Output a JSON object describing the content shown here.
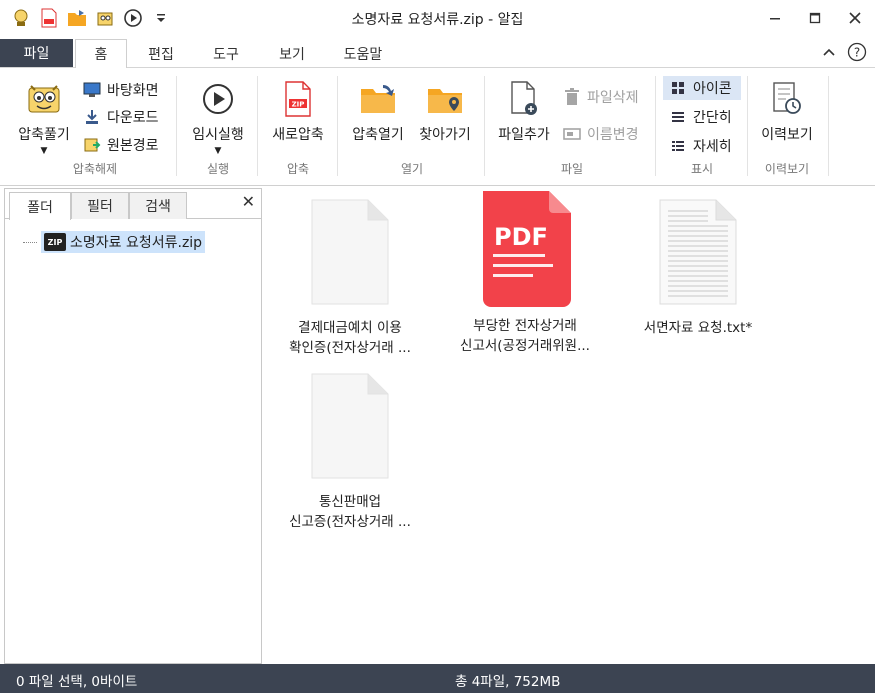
{
  "window": {
    "title": "소명자료 요청서류.zip - 알집"
  },
  "tabs": {
    "file": "파일",
    "items": [
      "홈",
      "편집",
      "도구",
      "보기",
      "도움말"
    ]
  },
  "ribbon": {
    "extract": {
      "big_label": "압축풀기",
      "desktop": "바탕화면",
      "download": "다운로드",
      "original_path": "원본경로",
      "group": "압축해제"
    },
    "run": {
      "label": "임시실행",
      "group": "실행"
    },
    "compress": {
      "label": "새로압축",
      "group": "압축"
    },
    "open": {
      "open_label": "압축열기",
      "find_label": "찾아가기",
      "group": "열기"
    },
    "file": {
      "add_label": "파일추가",
      "delete_label": "파일삭제",
      "rename_label": "이름변경",
      "group": "파일"
    },
    "view": {
      "icon": "아이콘",
      "simple": "간단히",
      "detail": "자세히",
      "group": "표시"
    },
    "history": {
      "label": "이력보기",
      "group": "이력보기"
    }
  },
  "left_panel": {
    "tabs": [
      "폴더",
      "필터",
      "검색"
    ],
    "close": "✕",
    "tree_root": "소명자료 요청서류.zip",
    "zip_badge": "ZIP"
  },
  "files": [
    {
      "line1": "결제대금예치 이용",
      "line2": "확인증(전자상거래 ...",
      "type": "blank"
    },
    {
      "line1": "부당한 전자상거래",
      "line2": "신고서(공정거래위원...",
      "type": "pdf",
      "badge": "PDF"
    },
    {
      "line1": "서면자료 요청.txt*",
      "line2": "",
      "type": "txt"
    },
    {
      "line1": "통신판매업",
      "line2": "신고증(전자상거래 ...",
      "type": "blank"
    }
  ],
  "status": {
    "left": "0 파일 선택,  0바이트",
    "right": "총 4파일,  752MB"
  },
  "colors": {
    "dark_bar": "#3c4452",
    "pdf_red": "#f2424a",
    "selected": "#cde3fb",
    "folder_orange": "#f5a623"
  }
}
